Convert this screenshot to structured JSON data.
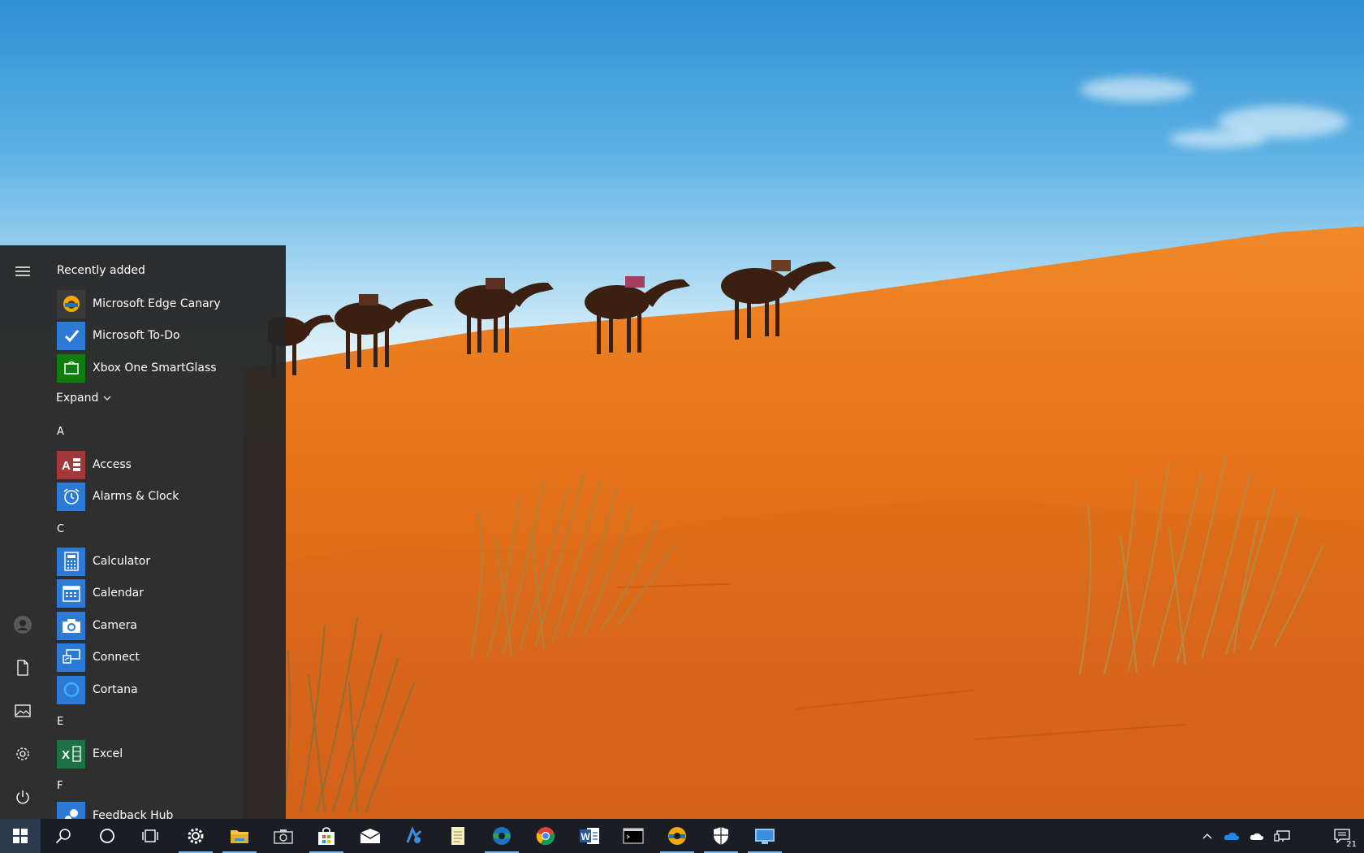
{
  "start_menu": {
    "recently_added_label": "Recently added",
    "expand_label": "Expand",
    "recent_apps": [
      {
        "name": "Microsoft Edge Canary",
        "tile_color": "#3a3a3a",
        "icon": "edge-canary-icon"
      },
      {
        "name": "Microsoft To-Do",
        "tile_color": "#2d7ad6",
        "icon": "checkmark-icon"
      },
      {
        "name": "Xbox One SmartGlass",
        "tile_color": "#107c10",
        "icon": "xbox-smartglass-icon"
      }
    ],
    "groups": [
      {
        "letter": "A",
        "apps": [
          {
            "name": "Access",
            "tile_color": "#a4373a",
            "icon": "access-icon"
          },
          {
            "name": "Alarms & Clock",
            "tile_color": "#2d7ad6",
            "icon": "alarm-clock-icon"
          }
        ]
      },
      {
        "letter": "C",
        "apps": [
          {
            "name": "Calculator",
            "tile_color": "#2d7ad6",
            "icon": "calculator-icon"
          },
          {
            "name": "Calendar",
            "tile_color": "#2d7ad6",
            "icon": "calendar-icon"
          },
          {
            "name": "Camera",
            "tile_color": "#2d7ad6",
            "icon": "camera-icon"
          },
          {
            "name": "Connect",
            "tile_color": "#2d7ad6",
            "icon": "connect-icon"
          },
          {
            "name": "Cortana",
            "tile_color": "#2d7ad6",
            "icon": "cortana-icon"
          }
        ]
      },
      {
        "letter": "E",
        "apps": [
          {
            "name": "Excel",
            "tile_color": "#1e7145",
            "icon": "excel-icon"
          }
        ]
      },
      {
        "letter": "F",
        "apps": [
          {
            "name": "Feedback Hub",
            "tile_color": "#2d7ad6",
            "icon": "feedback-hub-icon"
          }
        ]
      }
    ],
    "rail": [
      "menu-icon",
      "user-avatar-icon",
      "documents-icon",
      "pictures-icon",
      "settings-icon",
      "power-icon"
    ]
  },
  "taskbar": {
    "notification_count": "21",
    "pinned": [
      "start",
      "search",
      "cortana",
      "task-view",
      "settings",
      "file-explorer",
      "camera",
      "store",
      "mail",
      "app-a",
      "notepad",
      "edge-dev",
      "chrome",
      "word",
      "terminal",
      "edge-canary",
      "security",
      "remote-desktop"
    ],
    "accent": "#7eb4ea"
  }
}
